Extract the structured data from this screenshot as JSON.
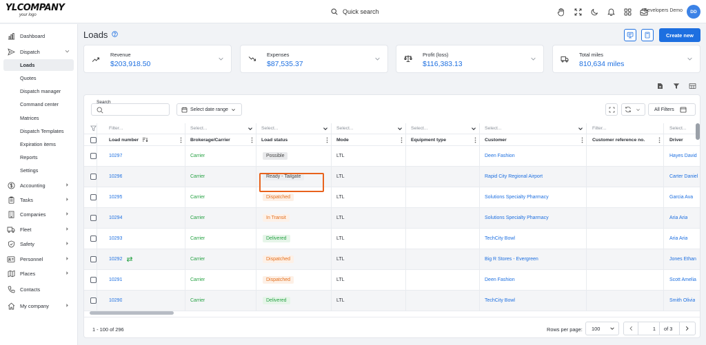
{
  "app": {
    "logo_main": "YLCOMPANY",
    "logo_sub": "your logo",
    "quick_search": "Quick search",
    "user_name": "Developers Demo",
    "user_initials": "DD",
    "top_icons": [
      "hand-icon",
      "expand-icon",
      "moon-icon",
      "bell-icon",
      "apps-grid-icon",
      "inbox-icon"
    ]
  },
  "sidebar": {
    "items": [
      {
        "label": "Dashboard",
        "icon": "chart-icon"
      },
      {
        "label": "Dispatch",
        "icon": "send-icon",
        "expanded": true
      },
      {
        "label": "Accounting",
        "icon": "dollar-icon"
      },
      {
        "label": "Tasks",
        "icon": "clipboard-icon"
      },
      {
        "label": "Companies",
        "icon": "building-icon"
      },
      {
        "label": "Fleet",
        "icon": "truck-icon"
      },
      {
        "label": "Safety",
        "icon": "shield-icon"
      },
      {
        "label": "Personnel",
        "icon": "id-card-icon"
      },
      {
        "label": "Places",
        "icon": "map-icon"
      },
      {
        "label": "Contacts",
        "icon": "phone-icon"
      },
      {
        "label": "My company",
        "icon": "home-icon"
      }
    ],
    "dispatch_sub": [
      "Loads",
      "Quotes",
      "Dispatch manager",
      "Command center",
      "Matrices",
      "Dispatch Templates",
      "Expiration items",
      "Reports",
      "Settings"
    ],
    "active_sub": "Loads"
  },
  "page": {
    "title": "Loads",
    "create_label": "Create new"
  },
  "stats": [
    {
      "label": "Revenue",
      "value": "$203,918.50",
      "icon": "trend-up-icon"
    },
    {
      "label": "Expenses",
      "value": "$87,535.37",
      "icon": "trend-down-icon"
    },
    {
      "label": "Profit (loss)",
      "value": "$116,383.13",
      "icon": "scale-icon"
    },
    {
      "label": "Total miles",
      "value": "810,634 miles",
      "icon": "truck-icon"
    }
  ],
  "toolbar": {
    "search_label": "Search",
    "date_range": "Select date range",
    "all_filters": "All Filters"
  },
  "table": {
    "filters": [
      "Filter...",
      "Select...",
      "Select...",
      "Select...",
      "Select...",
      "Select...",
      "Filter...",
      "Select..."
    ],
    "headers": [
      "Load number",
      "Brokerage/Carrier",
      "Load status",
      "Mode",
      "Equipment type",
      "Customer",
      "Customer reference no.",
      "Driver"
    ],
    "rows": [
      {
        "load": "10297",
        "brokerage": "Carrier",
        "status": "Possible",
        "status_kind": "possible",
        "mode": "LTL",
        "equipment": "",
        "customer": "Deen Fashion",
        "ref": "",
        "driver": "Hayes David",
        "transfer": false
      },
      {
        "load": "10296",
        "brokerage": "Carrier",
        "status": "Ready - Tailgate",
        "status_kind": "tailgate",
        "mode": "LTL",
        "equipment": "",
        "customer": "Rapid City Regional Airport",
        "ref": "",
        "driver": "Carter Daniel",
        "transfer": false
      },
      {
        "load": "10295",
        "brokerage": "Carrier",
        "status": "Dispatched",
        "status_kind": "dispatched",
        "mode": "LTL",
        "equipment": "",
        "customer": "Solutions Specialty Pharmacy",
        "ref": "",
        "driver": "Garcia Ava",
        "transfer": false
      },
      {
        "load": "10294",
        "brokerage": "Carrier",
        "status": "In Transit",
        "status_kind": "transit",
        "mode": "LTL",
        "equipment": "",
        "customer": "Solutions Specialty Pharmacy",
        "ref": "",
        "driver": "Aria Aria",
        "transfer": false
      },
      {
        "load": "10293",
        "brokerage": "Carrier",
        "status": "Delivered",
        "status_kind": "delivered",
        "mode": "LTL",
        "equipment": "",
        "customer": "TechCity Bowl",
        "ref": "",
        "driver": "Aria Aria",
        "transfer": false
      },
      {
        "load": "10292",
        "brokerage": "Carrier",
        "status": "Dispatched",
        "status_kind": "dispatched",
        "mode": "LTL",
        "equipment": "",
        "customer": "Big R Stores - Evergreen",
        "ref": "",
        "driver": "Jones Ethan",
        "transfer": true
      },
      {
        "load": "10291",
        "brokerage": "Carrier",
        "status": "Dispatched",
        "status_kind": "dispatched",
        "mode": "LTL",
        "equipment": "",
        "customer": "Deen Fashion",
        "ref": "",
        "driver": "Scott Amelia",
        "transfer": false
      },
      {
        "load": "10290",
        "brokerage": "Carrier",
        "status": "Delivered",
        "status_kind": "delivered",
        "mode": "LTL",
        "equipment": "",
        "customer": "TechCity Bowl",
        "ref": "",
        "driver": "Smith Olivia",
        "transfer": false
      }
    ]
  },
  "footer": {
    "range": "1 - 100 of 296",
    "rows_per_page_label": "Rows per page:",
    "rows_per_page": "100",
    "page": "1",
    "of_pages": "of 3"
  },
  "colors": {
    "accent": "#1d6fe0",
    "carrier": "#27a244",
    "dispatched": "#e46e1b",
    "highlight": "#e8621c"
  }
}
